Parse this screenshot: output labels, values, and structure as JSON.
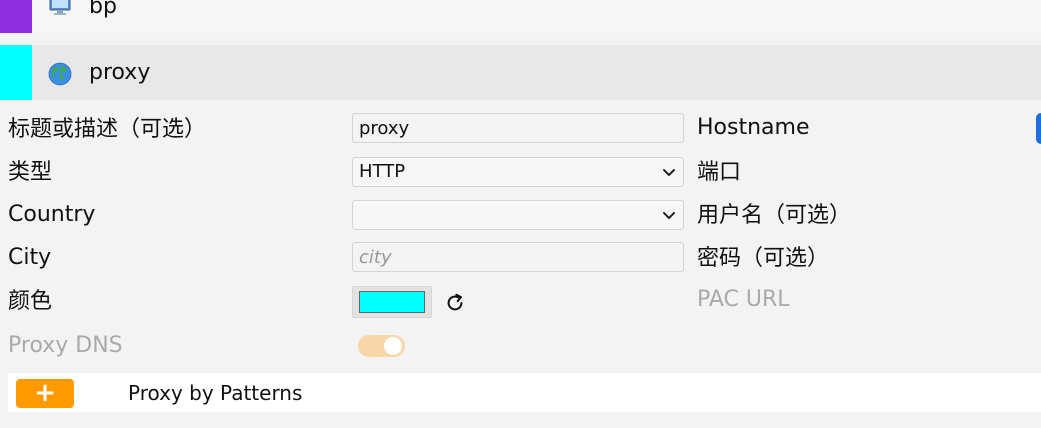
{
  "proxy_list": [
    {
      "title": "bp",
      "color": "#8e2de2",
      "icon": "computer-icon"
    },
    {
      "title": "proxy",
      "color": "#00ffff",
      "icon": "globe-icon"
    }
  ],
  "form": {
    "title_label": "标题或描述（可选）",
    "title_value": "proxy",
    "type_label": "类型",
    "type_value": "HTTP",
    "country_label": "Country",
    "country_value": "",
    "city_label": "City",
    "city_placeholder": "city",
    "color_label": "颜色",
    "color_value": "#00ffff",
    "proxy_dns_label": "Proxy DNS",
    "proxy_dns_enabled": true,
    "hostname_label": "Hostname",
    "port_label": "端口",
    "username_label": "用户名（可选）",
    "password_label": "密码（可选）",
    "pac_url_label": "PAC URL"
  },
  "patterns": {
    "add_label": "+",
    "label": "Proxy by Patterns"
  },
  "colors": {
    "accent_orange": "#ff9900",
    "toggle_track": "#f7d6a8",
    "edge_blue": "#1e6fd9"
  }
}
